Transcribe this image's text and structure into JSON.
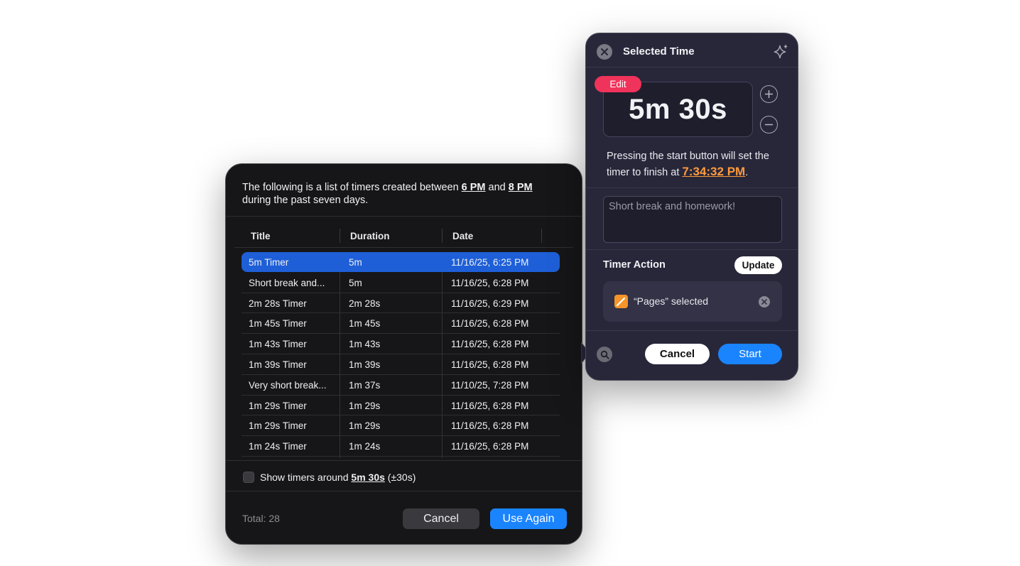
{
  "history": {
    "intro_prefix": "The following is a list of timers created between ",
    "intro_from": "6 PM",
    "intro_and": " and ",
    "intro_to": "8 PM",
    "intro_suffix": "during the past seven days.",
    "columns": {
      "title": "Title",
      "duration": "Duration",
      "date": "Date"
    },
    "rows": [
      {
        "title": "5m Timer",
        "duration": "5m",
        "date": "11/16/25, 6:25 PM"
      },
      {
        "title": "Short break and...",
        "duration": "5m",
        "date": "11/16/25, 6:28 PM"
      },
      {
        "title": "2m 28s Timer",
        "duration": "2m 28s",
        "date": "11/16/25, 6:29 PM"
      },
      {
        "title": "1m 45s Timer",
        "duration": "1m 45s",
        "date": "11/16/25, 6:28 PM"
      },
      {
        "title": "1m 43s Timer",
        "duration": "1m 43s",
        "date": "11/16/25, 6:28 PM"
      },
      {
        "title": "1m 39s Timer",
        "duration": "1m 39s",
        "date": "11/16/25, 6:28 PM"
      },
      {
        "title": "Very short break...",
        "duration": "1m 37s",
        "date": "11/10/25, 7:28 PM"
      },
      {
        "title": "1m 29s Timer",
        "duration": "1m 29s",
        "date": "11/16/25, 6:28 PM"
      },
      {
        "title": "1m 29s Timer",
        "duration": "1m 29s",
        "date": "11/16/25, 6:28 PM"
      },
      {
        "title": "1m 24s Timer",
        "duration": "1m 24s",
        "date": "11/16/25, 6:28 PM"
      }
    ],
    "show_prefix": "Show timers around ",
    "show_value": "5m 30s",
    "show_suffix": " (±30s)",
    "total": "Total: 28",
    "cancel_label": "Cancel",
    "use_again_label": "Use Again"
  },
  "selected": {
    "title": "Selected Time",
    "edit_label": "Edit",
    "time": "5m 30s",
    "finish_text": "Pressing the start button will set the timer to finish at ",
    "finish_time": "7:34:32 PM",
    "finish_period": ".",
    "note_placeholder": "Short break and homework!",
    "timer_action_label": "Timer Action",
    "update_label": "Update",
    "action_text": "“Pages” selected",
    "cancel_label": "Cancel",
    "start_label": "Start"
  },
  "colors": {
    "accent_blue": "#1a84ff",
    "edit_red": "#f0335a",
    "finish_orange": "#ff9a3c",
    "row_selected": "#1e5fd8"
  }
}
